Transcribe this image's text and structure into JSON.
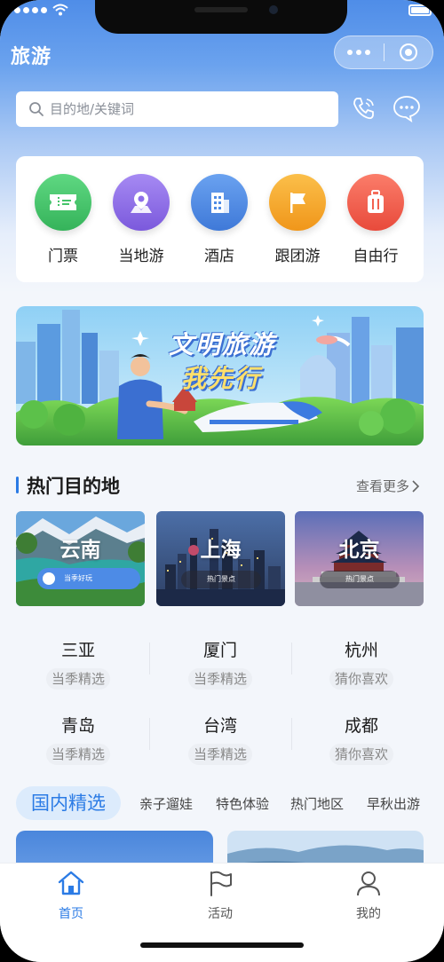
{
  "header": {
    "title": "旅游"
  },
  "search": {
    "placeholder": "目的地/关键词"
  },
  "categories": [
    {
      "label": "门票",
      "icon": "ticket-icon",
      "color": "#46c46a"
    },
    {
      "label": "当地游",
      "icon": "map-pin-icon",
      "color": "#8d6ee8"
    },
    {
      "label": "酒店",
      "icon": "building-icon",
      "color": "#4d8be6"
    },
    {
      "label": "跟团游",
      "icon": "flag-icon",
      "color": "#f6a523"
    },
    {
      "label": "自由行",
      "icon": "luggage-icon",
      "color": "#f2614f"
    }
  ],
  "banner": {
    "line1": "文明旅游",
    "line2": "我先行"
  },
  "hot": {
    "title": "热门目的地",
    "more": "查看更多",
    "destinations": [
      {
        "name": "云南",
        "tag": "当季好玩"
      },
      {
        "name": "上海",
        "tag": "热门景点"
      },
      {
        "name": "北京",
        "tag": "热门景点"
      }
    ]
  },
  "cities": [
    {
      "name": "三亚",
      "sub": "当季精选"
    },
    {
      "name": "厦门",
      "sub": "当季精选"
    },
    {
      "name": "杭州",
      "sub": "猜你喜欢"
    },
    {
      "name": "青岛",
      "sub": "当季精选"
    },
    {
      "name": "台湾",
      "sub": "当季精选"
    },
    {
      "name": "成都",
      "sub": "猜你喜欢"
    }
  ],
  "tabs": {
    "active": "国内精选",
    "items": [
      "亲子遛娃",
      "特色体验",
      "热门地区",
      "早秋出游"
    ]
  },
  "tabbar": [
    {
      "label": "首页",
      "icon": "home-icon",
      "active": true
    },
    {
      "label": "活动",
      "icon": "flag-outline-icon",
      "active": false
    },
    {
      "label": "我的",
      "icon": "user-icon",
      "active": false
    }
  ]
}
